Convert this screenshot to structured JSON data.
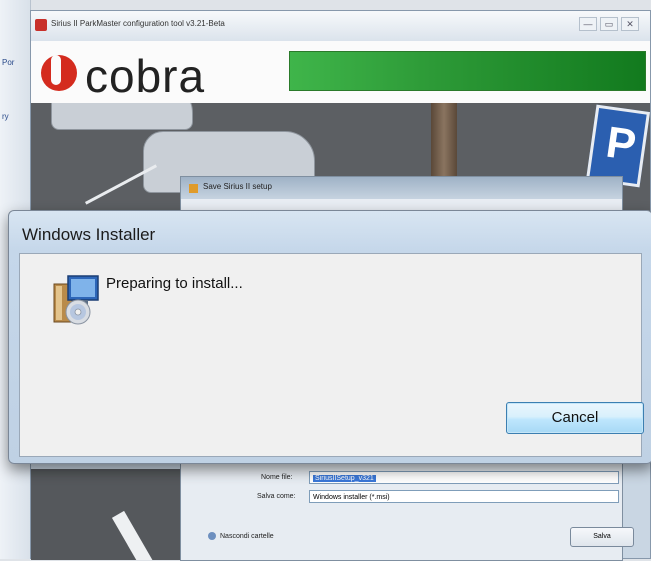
{
  "left_strip": {
    "items": [
      "Por",
      "ry"
    ]
  },
  "app_window": {
    "title": "Sirius II ParkMaster configuration tool v3.21-Beta",
    "logo_text": "cobra",
    "controls": {
      "minimize": "—",
      "maximize": "▭",
      "close": "✕"
    }
  },
  "save_dialog": {
    "title": "Save Sirius II setup",
    "file_name_label": "Nome file:",
    "file_name_value": "SiriusIISetup_v321",
    "save_as_label": "Salva come:",
    "save_as_value": "Windows installer (*.msi)",
    "hide_folders_label": "Nascondi cartelle",
    "save_button": "Salva"
  },
  "installer": {
    "title": "Windows Installer",
    "message": "Preparing to install...",
    "cancel_button": "Cancel"
  },
  "colors": {
    "header_bar": "#2d9a37",
    "logo_red": "#d42b1e",
    "parking_sign": "#2b5fb0"
  }
}
